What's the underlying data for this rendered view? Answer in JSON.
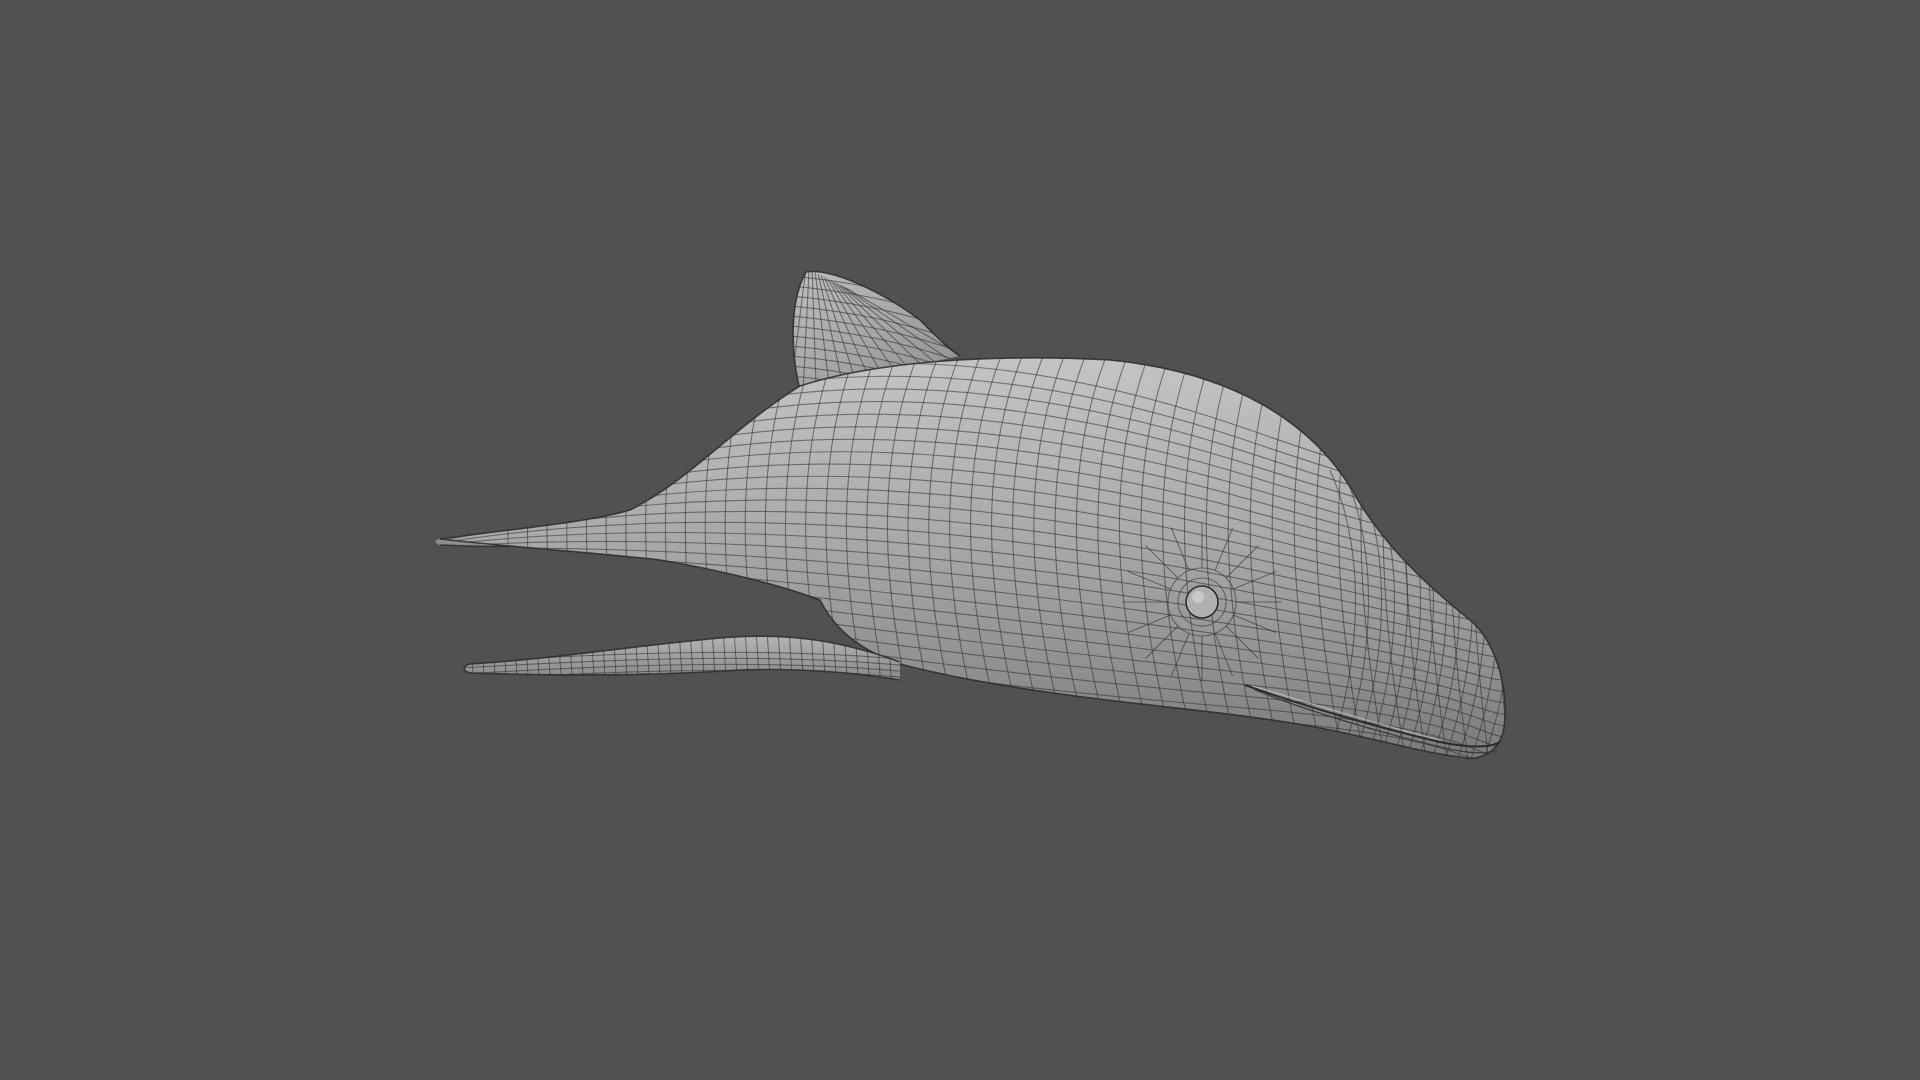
{
  "viewport": {
    "background_color": "#515151",
    "mesh_color": "#9a9a9a",
    "wireframe_color": "#2e2e2e",
    "subject": "dolphin-mesh",
    "display_mode": "wireframe-on-shaded"
  }
}
